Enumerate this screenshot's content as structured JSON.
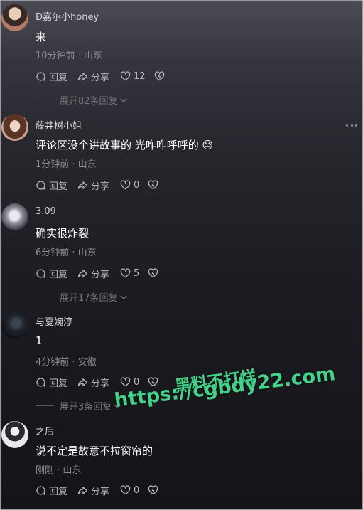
{
  "comments": [
    {
      "username": "Ð嘉尔小honey",
      "text": "来",
      "meta": "10分钟前 · 山东",
      "reply_label": "回复",
      "share_label": "分享",
      "likes": "12",
      "expand_label": "展开82条回复"
    },
    {
      "username": "藤井树小姐",
      "text": "评论区没个讲故事的 光咋咋呼呼的 😓",
      "meta": "1分钟前 · 山东",
      "reply_label": "回复",
      "share_label": "分享",
      "likes": "0"
    },
    {
      "username": "3.09",
      "text": "确实很炸裂",
      "meta": "6分钟前 · 山东",
      "reply_label": "回复",
      "share_label": "分享",
      "likes": "5",
      "expand_label": "展开17条回复"
    },
    {
      "username": "与夏婉淳",
      "text": "1",
      "meta": "4分钟前 · 安徽",
      "reply_label": "回复",
      "share_label": "分享",
      "likes": "0",
      "expand_label": "展开3条回复"
    },
    {
      "username": "之后",
      "text": "说不定是故意不拉窗帘的",
      "meta": "刚刚 · 山东",
      "reply_label": "回复",
      "share_label": "分享",
      "likes": "0"
    }
  ],
  "watermark": {
    "line1": "黑料不打烊",
    "line2": "https://cgbdy22.com",
    "color": "#44d28a"
  },
  "icons": [
    "comment-icon",
    "share-icon",
    "heart-icon",
    "dislike-icon",
    "chevron-down-icon",
    "more-icon"
  ]
}
